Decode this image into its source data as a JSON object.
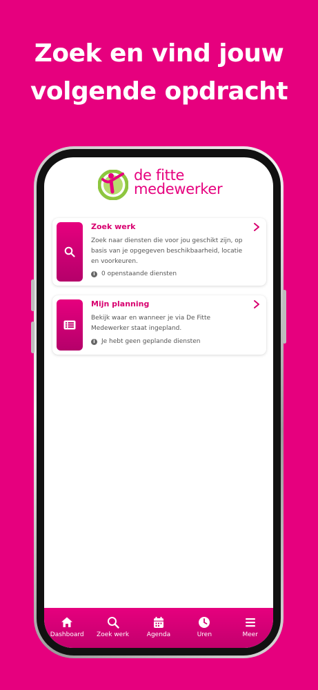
{
  "headline": {
    "line1": "Zoek en vind jouw",
    "line2": "volgende opdracht"
  },
  "brand": {
    "logo_line1": "de fitte",
    "logo_line2": "medewerker",
    "primary_color": "#e6007e",
    "logo_green": "#8dc63f"
  },
  "cards": [
    {
      "title": "Zoek werk",
      "description": "Zoek naar diensten die voor jou geschikt zijn, op basis van je opgegeven beschikbaarheid, locatie en voorkeuren.",
      "status": "0 openstaande diensten",
      "icon": "search-icon"
    },
    {
      "title": "Mijn planning",
      "description": "Bekijk waar en wanneer je via De Fitte Medewerker staat ingepland.",
      "status": "Je hebt geen geplande diensten",
      "icon": "list-icon"
    }
  ],
  "nav": [
    {
      "label": "Dashboard",
      "icon": "home-icon"
    },
    {
      "label": "Zoek werk",
      "icon": "search-icon"
    },
    {
      "label": "Agenda",
      "icon": "calendar-icon"
    },
    {
      "label": "Uren",
      "icon": "clock-icon"
    },
    {
      "label": "Meer",
      "icon": "menu-icon"
    }
  ]
}
